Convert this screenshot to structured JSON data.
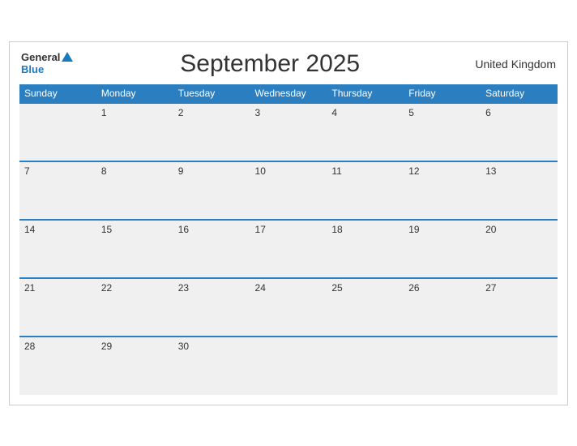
{
  "header": {
    "logo_general": "General",
    "logo_blue": "Blue",
    "title": "September 2025",
    "region": "United Kingdom"
  },
  "days_of_week": [
    "Sunday",
    "Monday",
    "Tuesday",
    "Wednesday",
    "Thursday",
    "Friday",
    "Saturday"
  ],
  "weeks": [
    [
      null,
      1,
      2,
      3,
      4,
      5,
      6
    ],
    [
      7,
      8,
      9,
      10,
      11,
      12,
      13
    ],
    [
      14,
      15,
      16,
      17,
      18,
      19,
      20
    ],
    [
      21,
      22,
      23,
      24,
      25,
      26,
      27
    ],
    [
      28,
      29,
      30,
      null,
      null,
      null,
      null
    ]
  ]
}
